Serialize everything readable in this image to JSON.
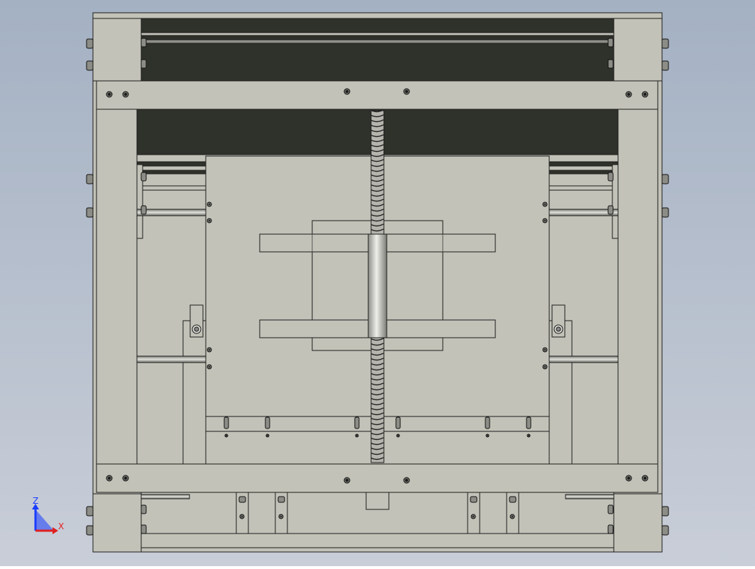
{
  "view": {
    "background_top": "#a4b1c3",
    "background_bottom": "#c9ced8",
    "part_fill": "#c2c2b8",
    "part_stroke": "#1c1c1c",
    "dark_fill": "#2f312b",
    "shaft_fill": "#d6d6d0"
  },
  "triad": {
    "z_label": "Z",
    "x_label": "X",
    "z_color": "#1a3cff",
    "x_color": "#e02020",
    "y_color": "#20b040"
  }
}
